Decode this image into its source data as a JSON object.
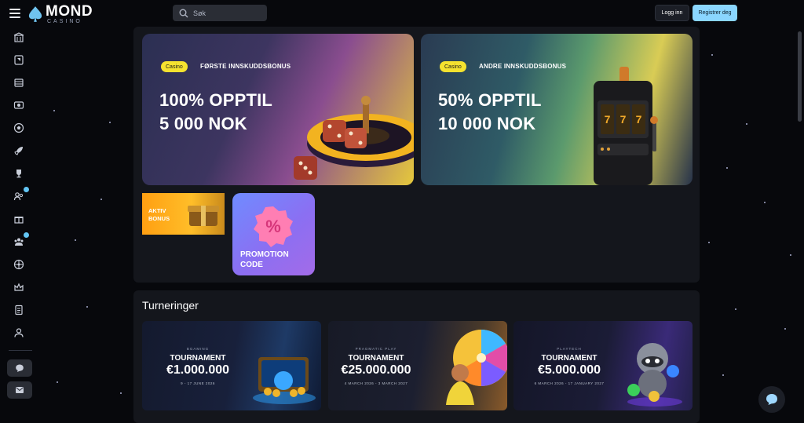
{
  "brand": {
    "name": "MOND",
    "sub": "CASINO"
  },
  "search": {
    "placeholder": "Søk"
  },
  "header": {
    "login_label": "Logg inn",
    "register_label": "Registrer deg"
  },
  "sidebar": {
    "items": [
      {
        "icon": "casino-icon"
      },
      {
        "icon": "cards-icon"
      },
      {
        "icon": "slot-machine-icon"
      },
      {
        "icon": "live-casino-icon"
      },
      {
        "icon": "soccer-ball-icon"
      },
      {
        "icon": "rocket-icon"
      },
      {
        "icon": "trophy-icon"
      },
      {
        "icon": "friends-icon",
        "notification": true
      },
      {
        "icon": "gift-icon"
      },
      {
        "icon": "vip-group-icon",
        "notification": true
      },
      {
        "icon": "wheel-icon"
      },
      {
        "icon": "crown-icon"
      },
      {
        "icon": "document-icon"
      },
      {
        "icon": "support-agent-icon"
      }
    ],
    "bottom": [
      {
        "icon": "chat-icon"
      },
      {
        "icon": "mail-icon"
      }
    ]
  },
  "promos": [
    {
      "badge": "Casino",
      "label": "FØRSTE INNSKUDDSBONUS",
      "title_line1": "100% OPPTIL",
      "title_line2": "5 000 NOK"
    },
    {
      "badge": "Casino",
      "label": "ANDRE INNSKUDDSBONUS",
      "title_line1": "50% OPPTIL",
      "title_line2": "10 000 NOK"
    }
  ],
  "tiles": {
    "aktiv": {
      "line1": "AKTIV",
      "line2": "BONUS"
    },
    "promo_code": {
      "line1": "PROMOTION",
      "line2": "CODE"
    }
  },
  "tournaments": {
    "title": "Turneringer",
    "cards": [
      {
        "provider": "BGAMING",
        "name": "TOURNAMENT",
        "amount": "€1.000.000",
        "dates": "9 - 17 JUNE 2026"
      },
      {
        "provider": "PRAGMATIC PLAY",
        "name": "TOURNAMENT",
        "amount": "€25.000.000",
        "dates": "4 MARCH 2026 - 3 MARCH 2027"
      },
      {
        "provider": "PLAYTECH",
        "name": "TOURNAMENT",
        "amount": "€5.000.000",
        "dates": "6 MARCH 2026 - 17 JANUARY 2027"
      }
    ]
  },
  "colors": {
    "accent": "#8ad6ff",
    "badge": "#f5e22f",
    "notification": "#63c6f5"
  }
}
